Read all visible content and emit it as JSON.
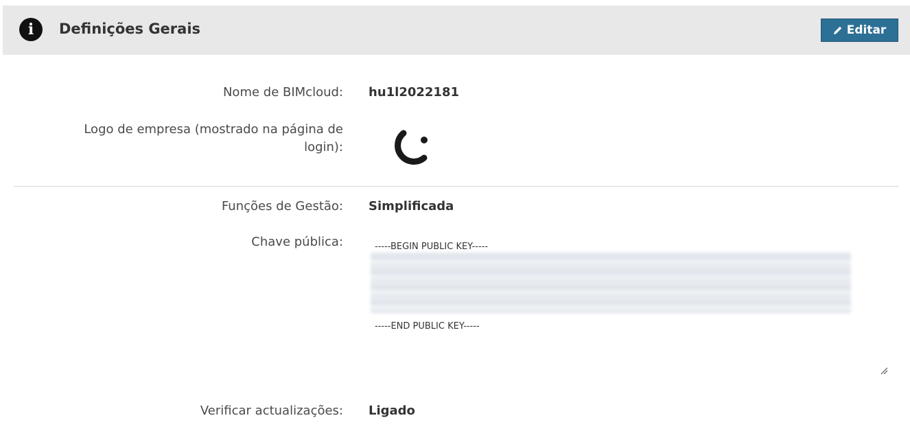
{
  "header": {
    "title": "Definições Gerais",
    "edit_label": "Editar",
    "colors": {
      "header_bg": "#e8e8e8",
      "button_bg": "#2d7096"
    }
  },
  "fields": {
    "bimcloud_name": {
      "label": "Nome de BIMcloud:",
      "value": "hu1l2022181"
    },
    "company_logo": {
      "label_line1": "Logo de empresa (mostrado na página de",
      "label_line2": "login):"
    },
    "management_roles": {
      "label": "Funções de Gestão:",
      "value": "Simplificada"
    },
    "public_key": {
      "label": "Chave pública:",
      "begin": "-----BEGIN PUBLIC KEY-----",
      "end": "-----END PUBLIC KEY-----"
    },
    "check_updates": {
      "label": "Verificar actualizações:",
      "value": "Ligado"
    }
  },
  "icons": [
    "info-icon",
    "pencil-icon",
    "company-logo",
    "resize-handle-icon"
  ]
}
